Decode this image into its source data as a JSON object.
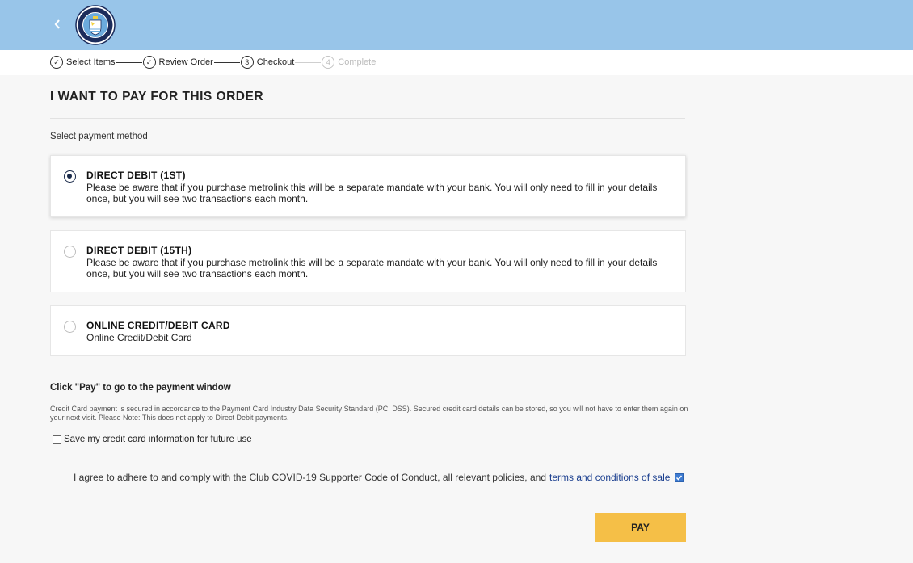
{
  "header": {
    "back_icon": "chevron-left-icon",
    "logo": {
      "name": "club-crest",
      "text_top": "MANCHESTER",
      "text_bottom": "CITY",
      "colors": {
        "navy": "#1c2c5b",
        "sky": "#6cabdd",
        "gold": "#f3d03e"
      }
    },
    "bar_color": "#98c5e9"
  },
  "steps": [
    {
      "label": "Select Items",
      "marker": "✓",
      "state": "done"
    },
    {
      "label": "Review Order",
      "marker": "✓",
      "state": "done"
    },
    {
      "label": "Checkout",
      "marker": "3",
      "state": "current"
    },
    {
      "label": "Complete",
      "marker": "4",
      "state": "disabled"
    }
  ],
  "page": {
    "title": "I WANT TO PAY FOR THIS ORDER",
    "select_label": "Select payment method"
  },
  "payment_methods": [
    {
      "title": "DIRECT DEBIT (1ST)",
      "desc": "Please be aware that if you purchase metrolink this will be a separate mandate with your bank. You will only need to fill in your details once, but you will see two transactions each month.",
      "selected": true
    },
    {
      "title": "DIRECT DEBIT (15TH)",
      "desc": "Please be aware that if you purchase metrolink this will be a separate mandate with your bank. You will only need to fill in your details once, but you will see two transactions each month.",
      "selected": false
    },
    {
      "title": "ONLINE CREDIT/DEBIT CARD",
      "desc": "Online Credit/Debit Card",
      "selected": false
    }
  ],
  "pay_section": {
    "heading": "Click \"Pay\" to go to the payment window",
    "security_note": "Credit Card payment is secured in accordance to the Payment Card Industry Data Security Standard (PCI DSS). Secured credit card details can be stored, so you will not have to enter them again on your next visit. Please Note: This does not apply to Direct Debit payments.",
    "save_card_label": "Save my credit card information for future use",
    "save_card_checked": false,
    "agree_text": "I agree to adhere to and comply with the Club COVID-19 Supporter Code of Conduct, all relevant policies, and",
    "agree_link": "terms and conditions of sale",
    "agree_checked": true,
    "pay_label": "PAY",
    "pay_color": "#f5bf47"
  }
}
